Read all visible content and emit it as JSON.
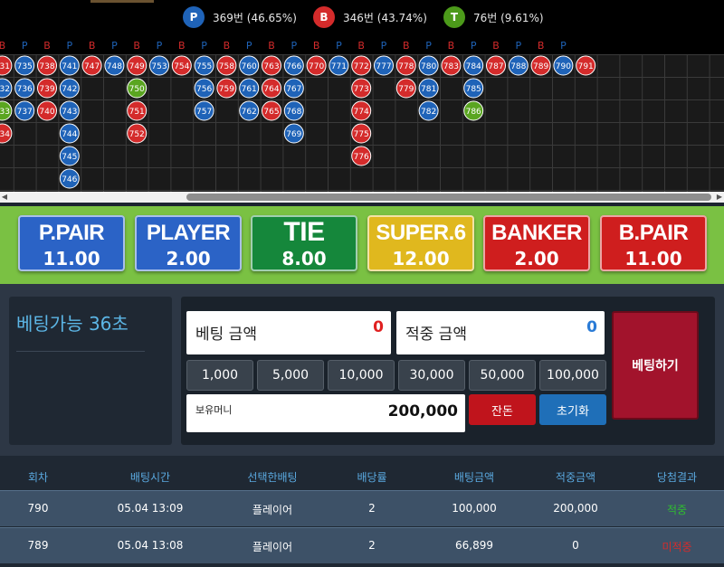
{
  "stats": [
    {
      "letter": "P",
      "text": "369번 (46.65%)",
      "color": "#1f63b8"
    },
    {
      "letter": "B",
      "text": "346번 (43.74%)",
      "color": "#d42b2b"
    },
    {
      "letter": "T",
      "text": "76번 (9.61%)",
      "color": "#4c9a1a"
    }
  ],
  "road": {
    "colors": {
      "P": "#1f63b8",
      "B": "#d42b2b",
      "T": "#5aa520"
    },
    "header_letters": [
      "B",
      "P",
      "B",
      "P",
      "B",
      "P",
      "B",
      "P",
      "B",
      "P",
      "B",
      "P",
      "B",
      "P",
      "B",
      "P",
      "B",
      "P",
      "B",
      "P",
      "B",
      "P",
      "B",
      "P",
      "B",
      "P"
    ],
    "columns": [
      [
        {
          "n": "731",
          "c": "B"
        },
        {
          "n": "732",
          "c": "P"
        },
        {
          "n": "733",
          "c": "T"
        },
        {
          "n": "734",
          "c": "B"
        }
      ],
      [
        {
          "n": "735",
          "c": "P"
        },
        {
          "n": "736",
          "c": "P"
        },
        {
          "n": "737",
          "c": "P"
        }
      ],
      [
        {
          "n": "738",
          "c": "B"
        },
        {
          "n": "739",
          "c": "B"
        },
        {
          "n": "740",
          "c": "B"
        }
      ],
      [
        {
          "n": "741",
          "c": "P"
        },
        {
          "n": "742",
          "c": "P"
        },
        {
          "n": "743",
          "c": "P"
        },
        {
          "n": "744",
          "c": "P"
        },
        {
          "n": "745",
          "c": "P"
        },
        {
          "n": "746",
          "c": "P"
        }
      ],
      [
        {
          "n": "747",
          "c": "B"
        }
      ],
      [
        {
          "n": "748",
          "c": "P"
        }
      ],
      [
        {
          "n": "749",
          "c": "B"
        },
        {
          "n": "750",
          "c": "T"
        },
        {
          "n": "751",
          "c": "B"
        },
        {
          "n": "752",
          "c": "B"
        }
      ],
      [
        {
          "n": "753",
          "c": "P"
        }
      ],
      [
        {
          "n": "754",
          "c": "B"
        }
      ],
      [
        {
          "n": "755",
          "c": "P"
        },
        {
          "n": "756",
          "c": "P"
        },
        {
          "n": "757",
          "c": "P"
        }
      ],
      [
        {
          "n": "758",
          "c": "B"
        },
        {
          "n": "759",
          "c": "B"
        }
      ],
      [
        {
          "n": "760",
          "c": "P"
        },
        {
          "n": "761",
          "c": "P"
        },
        {
          "n": "762",
          "c": "P"
        }
      ],
      [
        {
          "n": "763",
          "c": "B"
        },
        {
          "n": "764",
          "c": "B"
        },
        {
          "n": "765",
          "c": "B"
        }
      ],
      [
        {
          "n": "766",
          "c": "P"
        },
        {
          "n": "767",
          "c": "P"
        },
        {
          "n": "768",
          "c": "P"
        },
        {
          "n": "769",
          "c": "P"
        }
      ],
      [
        {
          "n": "770",
          "c": "B"
        }
      ],
      [
        {
          "n": "771",
          "c": "P"
        }
      ],
      [
        {
          "n": "772",
          "c": "B"
        },
        {
          "n": "773",
          "c": "B"
        },
        {
          "n": "774",
          "c": "B"
        },
        {
          "n": "775",
          "c": "B"
        },
        {
          "n": "776",
          "c": "B"
        }
      ],
      [
        {
          "n": "777",
          "c": "P"
        }
      ],
      [
        {
          "n": "778",
          "c": "B"
        },
        {
          "n": "779",
          "c": "B"
        }
      ],
      [
        {
          "n": "780",
          "c": "P"
        },
        {
          "n": "781",
          "c": "P"
        },
        {
          "n": "782",
          "c": "P"
        }
      ],
      [
        {
          "n": "783",
          "c": "B"
        }
      ],
      [
        {
          "n": "784",
          "c": "P"
        },
        {
          "n": "785",
          "c": "P"
        },
        {
          "n": "786",
          "c": "T"
        }
      ],
      [
        {
          "n": "787",
          "c": "B"
        }
      ],
      [
        {
          "n": "788",
          "c": "P"
        }
      ],
      [
        {
          "n": "789",
          "c": "B"
        }
      ],
      [
        {
          "n": "790",
          "c": "P"
        }
      ],
      [
        {
          "n": "791",
          "c": "B"
        }
      ]
    ],
    "scroll_left_glyph": "◀",
    "scroll_right_glyph": "▶"
  },
  "bets": [
    {
      "label": "P.PAIR",
      "odds": "11.00",
      "color": "#2b63c6"
    },
    {
      "label": "PLAYER",
      "odds": "2.00",
      "color": "#2b63c6"
    },
    {
      "label": "TIE",
      "odds": "8.00",
      "color": "#15873b"
    },
    {
      "label": "SUPER.6",
      "odds": "12.00",
      "color": "#e0b81e"
    },
    {
      "label": "BANKER",
      "odds": "2.00",
      "color": "#cf1e1e"
    },
    {
      "label": "B.PAIR",
      "odds": "11.00",
      "color": "#cf1e1e"
    }
  ],
  "timer_text": "베팅가능 36초",
  "bet_amount": {
    "label": "베팅 금액",
    "value": "0",
    "color": "#e02020"
  },
  "win_amount": {
    "label": "적중 금액",
    "value": "0",
    "color": "#2a7bd6"
  },
  "chips": [
    "1,000",
    "5,000",
    "10,000",
    "30,000",
    "50,000",
    "100,000"
  ],
  "balance": {
    "label": "보유머니",
    "value": "200,000"
  },
  "remainder_label": "잔돈",
  "reset_label": "초기화",
  "bet_button_label": "베팅하기",
  "history": {
    "headers": [
      "회차",
      "배팅시간",
      "선택한배팅",
      "배당률",
      "배팅금액",
      "적중금액",
      "당첨결과"
    ],
    "rows": [
      {
        "round": "790",
        "time": "05.04 13:09",
        "choice": "플레이어",
        "odds": "2",
        "amount": "100,000",
        "win": "200,000",
        "result": "적중",
        "result_color": "#2fbf2f"
      },
      {
        "round": "789",
        "time": "05.04 13:08",
        "choice": "플레이어",
        "odds": "2",
        "amount": "66,899",
        "win": "0",
        "result": "미적중",
        "result_color": "#d42b2b"
      }
    ]
  }
}
